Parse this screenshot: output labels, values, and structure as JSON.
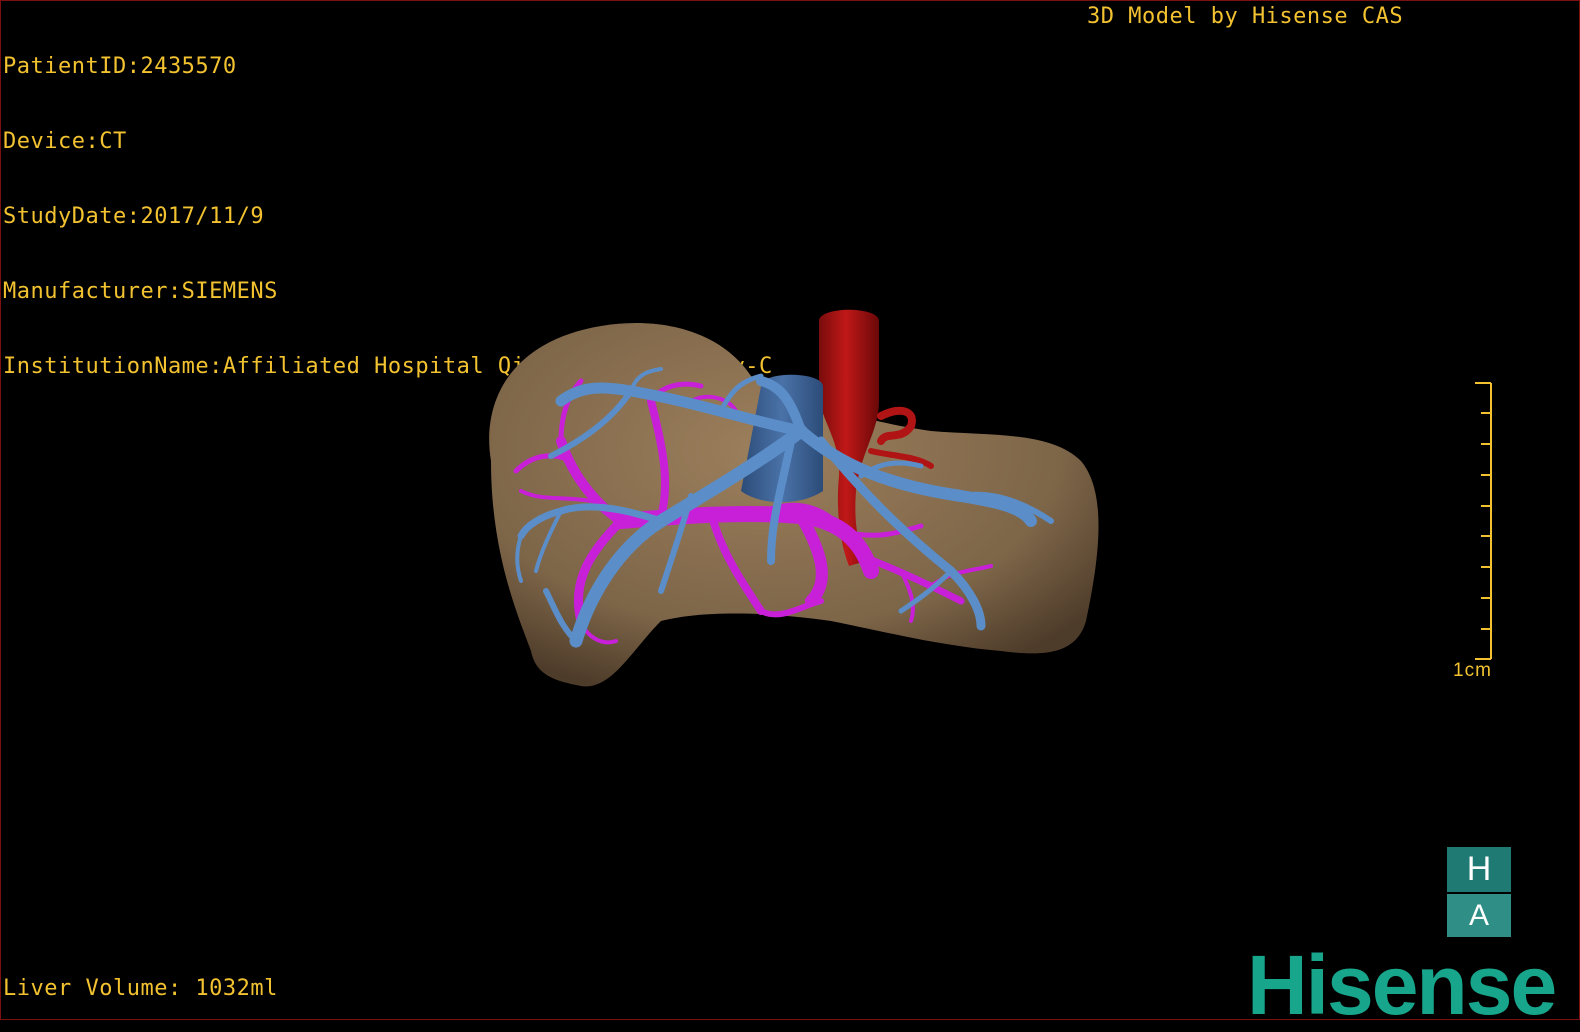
{
  "overlay": {
    "patient_id": "PatientID:2435570",
    "device": "Device:CT",
    "study_date": "StudyDate:2017/11/9",
    "manufacturer": "Manufacturer:SIEMENS",
    "institution": "InstitutionName:Affiliated Hospital Qingdao University-C",
    "credit": "3D Model by Hisense CAS",
    "liver_volume": "Liver Volume: 1032ml",
    "scale_label": "1cm"
  },
  "orientation": {
    "top": "H",
    "bottom": "A"
  },
  "logo": "Hisense",
  "colors": {
    "overlay_text": "#f2c230",
    "liver": "#7d6548",
    "hepatic_vein": "#5b8ec9",
    "portal_vein": "#c81fd8",
    "artery": "#b01414",
    "ivc": "#3a5f90",
    "logo": "#17a58c"
  },
  "model": {
    "structures": [
      "liver",
      "hepatic-vein",
      "portal-vein",
      "artery",
      "inferior-vena-cava"
    ]
  }
}
